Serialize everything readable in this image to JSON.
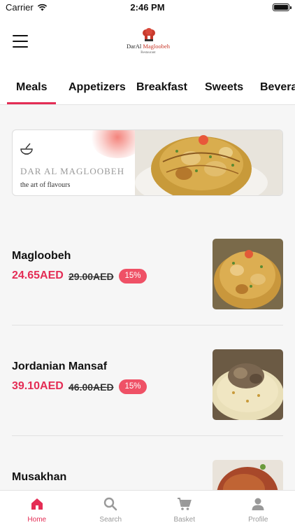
{
  "status_bar": {
    "carrier": "Carrier",
    "time": "2:46 PM"
  },
  "header": {
    "logo_text": "DarAl ",
    "logo_accent": "Magloobeh",
    "logo_sub": "Restaurant"
  },
  "tabs": [
    {
      "label": "Meals",
      "active": true
    },
    {
      "label": "Appetizers"
    },
    {
      "label": "Breakfast"
    },
    {
      "label": "Sweets"
    },
    {
      "label": "Beveral"
    }
  ],
  "banner": {
    "title": "DAR AL MAGLOOBEH",
    "subtitle": "the art of flavours"
  },
  "meals": [
    {
      "name": "Magloobeh",
      "price": "24.65AED",
      "old_price": "29.00AED",
      "discount": "15%"
    },
    {
      "name": "Jordanian Mansaf",
      "price": "39.10AED",
      "old_price": "46.00AED",
      "discount": "15%"
    },
    {
      "name": "Musakhan"
    }
  ],
  "bottom_nav": [
    {
      "label": "Home",
      "icon": "home-icon",
      "active": true
    },
    {
      "label": "Search",
      "icon": "search-icon"
    },
    {
      "label": "Basket",
      "icon": "basket-icon"
    },
    {
      "label": "Profile",
      "icon": "profile-icon"
    }
  ],
  "colors": {
    "accent": "#e42d55",
    "badge": "#ef5166",
    "inactive": "#999999"
  }
}
